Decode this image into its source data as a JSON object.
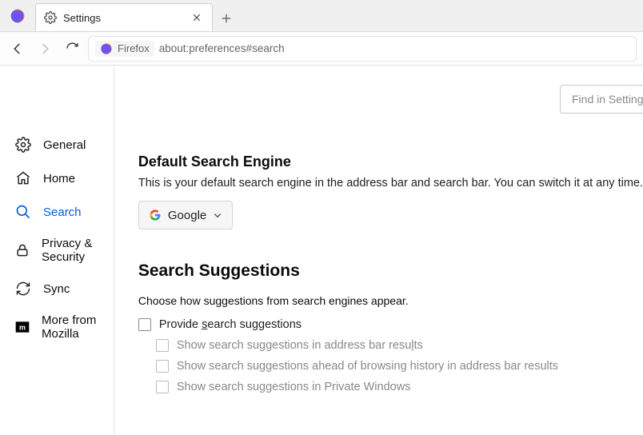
{
  "tab": {
    "title": "Settings"
  },
  "urlbar": {
    "identity_label": "Firefox",
    "address": "about:preferences#search"
  },
  "find": {
    "placeholder": "Find in Settings"
  },
  "sidebar": {
    "items": [
      {
        "label": "General"
      },
      {
        "label": "Home"
      },
      {
        "label": "Search"
      },
      {
        "label": "Privacy & Security"
      },
      {
        "label": "Sync"
      },
      {
        "label": "More from Mozilla"
      }
    ]
  },
  "sections": {
    "default_engine": {
      "heading": "Default Search Engine",
      "description": "This is your default search engine in the address bar and search bar. You can switch it at any time.",
      "selected": "Google"
    },
    "suggestions": {
      "heading": "Search Suggestions",
      "description": "Choose how suggestions from search engines appear.",
      "provide_prefix": "Provide ",
      "provide_s": "s",
      "provide_suffix": "earch suggestions",
      "sub1_prefix": "Show search suggestions in address bar resu",
      "sub1_l": "l",
      "sub1_suffix": "ts",
      "sub2": "Show search suggestions ahead of browsing history in address bar results",
      "sub3": "Show search suggestions in Private Windows"
    }
  }
}
